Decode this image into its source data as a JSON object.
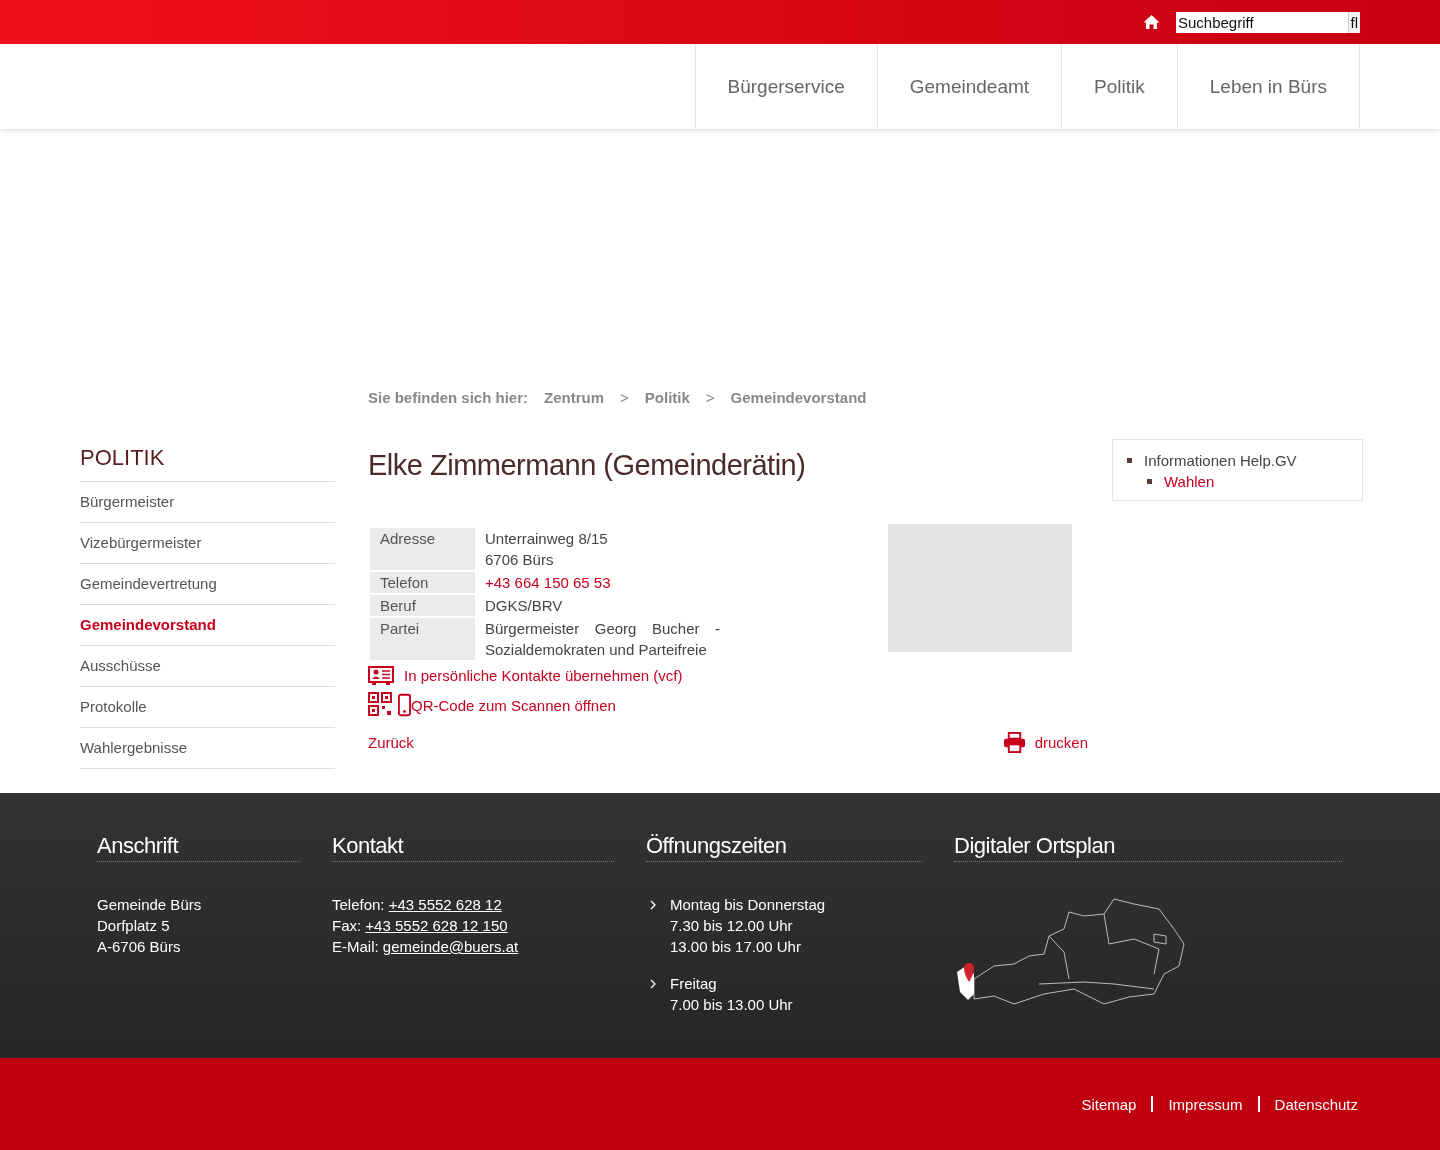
{
  "topbar": {
    "search": {
      "value": "Suchbegriff",
      "button": "fl"
    }
  },
  "nav": {
    "items": [
      "Bürgerservice",
      "Gemeindeamt",
      "Politik",
      "Leben in Bürs"
    ]
  },
  "breadcrumb": {
    "label": "Sie befinden sich hier:",
    "separator": ">",
    "items": [
      "Zentrum",
      "Politik",
      "Gemeindevorstand"
    ]
  },
  "sidebar": {
    "title": "POLITIK",
    "items": [
      {
        "label": "Bürgermeister",
        "selected": false
      },
      {
        "label": "Vizebürgermeister",
        "selected": false
      },
      {
        "label": "Gemeindevertretung",
        "selected": false
      },
      {
        "label": "Gemeindevorstand",
        "selected": true
      },
      {
        "label": "Ausschüsse",
        "selected": false
      },
      {
        "label": "Protokolle",
        "selected": false
      },
      {
        "label": "Wahlergebnisse",
        "selected": false
      }
    ]
  },
  "person": {
    "title": "Elke Zimmermann (Gemeinderätin)",
    "details": [
      {
        "label": "Adresse",
        "lines": [
          "Unterrainweg 8/15",
          "6706 Bürs"
        ],
        "kind": "text"
      },
      {
        "label": "Telefon",
        "lines": [
          "+43 664 150 65 53"
        ],
        "kind": "link"
      },
      {
        "label": "Beruf",
        "lines": [
          "DGKS/BRV"
        ],
        "kind": "text"
      },
      {
        "label": "Partei",
        "lines": [
          "Bürgermeister Georg Bucher - Sozialdemokraten und Parteifreie"
        ],
        "kind": "text"
      }
    ],
    "vcf_link": "In persönliche Kontakte übernehmen (vcf)",
    "qr_link": "QR-Code zum Scannen öffnen",
    "back_link": "Zurück",
    "print_link": "drucken"
  },
  "related": {
    "items": [
      {
        "label": "Informationen Help.GV",
        "children": [
          {
            "label": "Wahlen"
          }
        ]
      }
    ]
  },
  "footer": {
    "columns": [
      {
        "kind": "lines",
        "title": "Anschrift",
        "lines": [
          "Gemeinde Bürs",
          "Dorfplatz 5",
          "A-6706 Bürs"
        ]
      },
      {
        "kind": "contacts",
        "title": "Kontakt",
        "lines": [
          {
            "label": "Telefon:",
            "link": "+43 5552 628 12"
          },
          {
            "label": "Fax:",
            "link": "+43 5552 628 12 150"
          },
          {
            "label": "E-Mail:",
            "link": "gemeinde@buers.at"
          }
        ]
      },
      {
        "kind": "hours",
        "title": "Öffnungszeiten",
        "entries": [
          {
            "day": "Montag bis Donnerstag",
            "times": [
              "7.30 bis 12.00 Uhr",
              "13.00 bis 17.00 Uhr"
            ]
          },
          {
            "day": "Freitag",
            "times": [
              "7.00 bis 13.00 Uhr"
            ]
          }
        ]
      },
      {
        "kind": "map",
        "title": "Digitaler Ortsplan"
      }
    ]
  },
  "bottom_links": [
    "Sitemap",
    "Impressum",
    "Datenschutz"
  ]
}
